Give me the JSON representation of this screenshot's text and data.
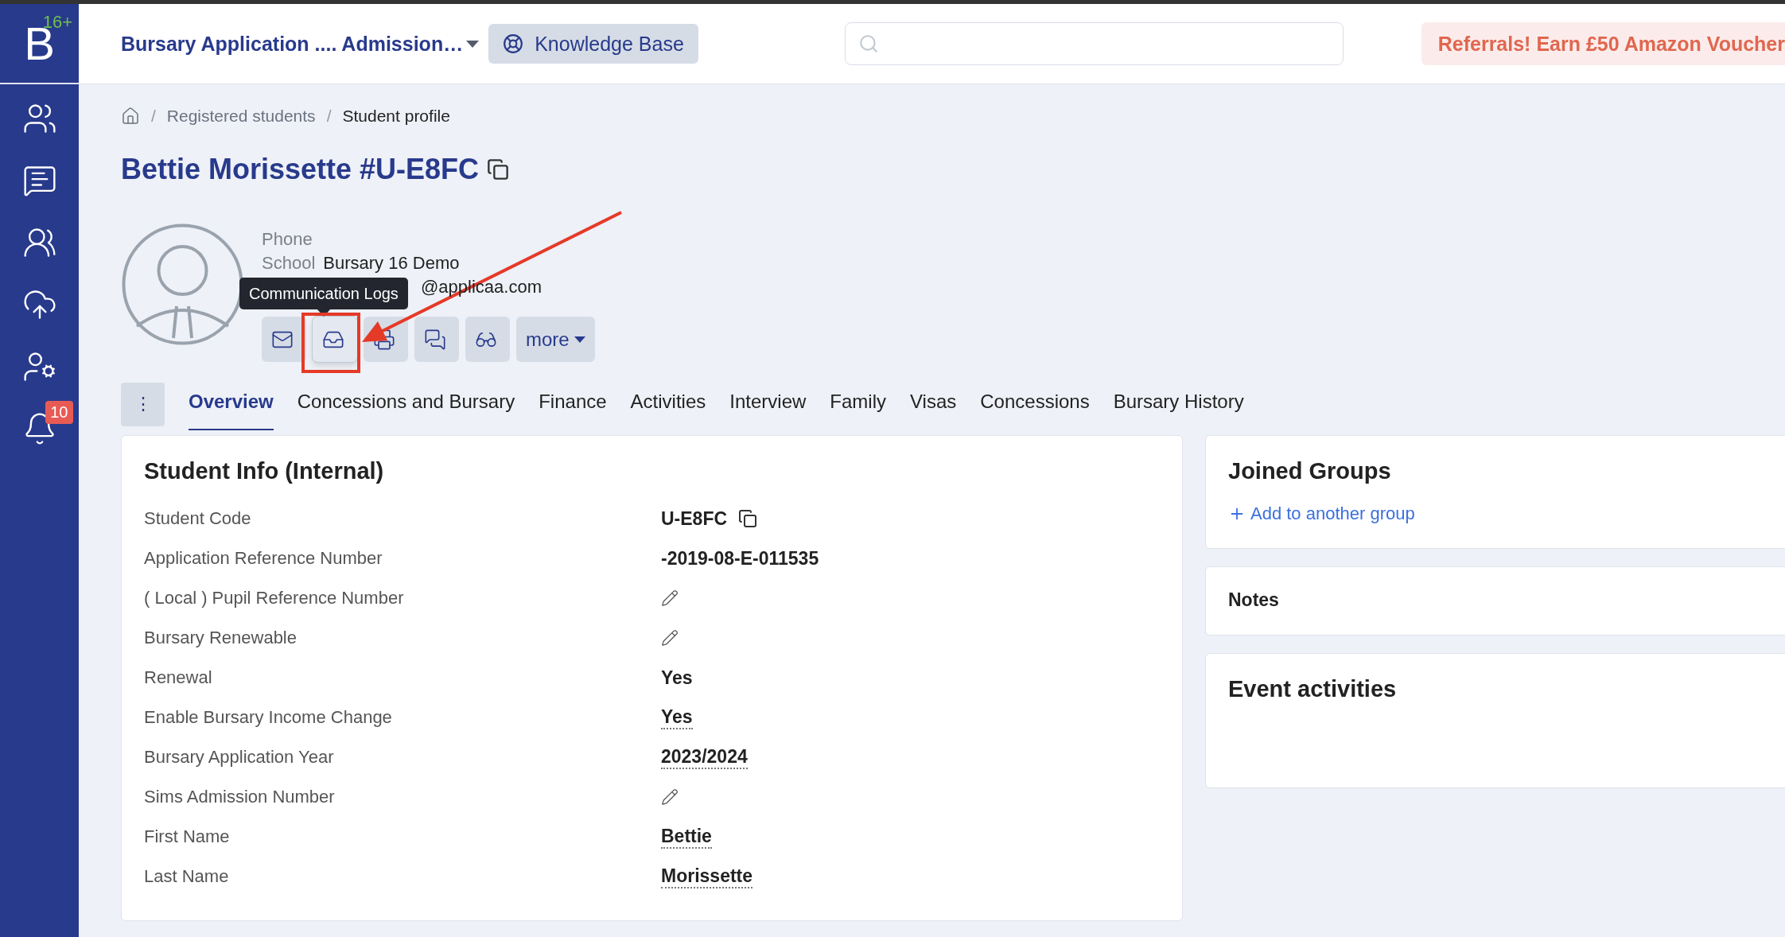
{
  "sidebar": {
    "logo": "B",
    "logo_badge": "16+",
    "items": [
      {
        "kind": "people"
      },
      {
        "kind": "messages"
      },
      {
        "kind": "groups"
      },
      {
        "kind": "upload"
      },
      {
        "kind": "settings"
      },
      {
        "kind": "bell",
        "badge": "10"
      }
    ]
  },
  "topbar": {
    "app_switcher": "Bursary Application .... Admission…",
    "knowledge_base": "Knowledge Base",
    "referral": "Referrals! Earn £50 Amazon Voucher"
  },
  "breadcrumbs": [
    "Registered students",
    "Student profile"
  ],
  "breadcrumb_separator": "/",
  "tabs_menu": "⋮",
  "profile": {
    "name": "Bettie Morissette",
    "code": "#U-E8FC",
    "info": [
      {
        "label": "Phone"
      },
      {
        "label": "School",
        "value": "Bursary 16 Demo"
      },
      {
        "value": "@applicaa.com"
      }
    ],
    "actions": [
      {
        "kind": "mail",
        "hovered": false
      },
      {
        "kind": "inbox",
        "hovered": true
      },
      {
        "kind": "print",
        "hovered": false
      },
      {
        "kind": "chat",
        "hovered": false
      },
      {
        "kind": "glasses",
        "hovered": false
      },
      {
        "kind": "more",
        "label": "more",
        "hovered": false
      }
    ],
    "tooltip": "Communication Logs"
  },
  "tabs": [
    {
      "label": "Overview",
      "selected": true
    },
    {
      "label": "Concessions and Bursary",
      "selected": false
    },
    {
      "label": "Finance",
      "selected": false
    },
    {
      "label": "Activities",
      "selected": false
    },
    {
      "label": "Interview",
      "selected": false
    },
    {
      "label": "Family",
      "selected": false
    },
    {
      "label": "Visas",
      "selected": false
    },
    {
      "label": "Concessions",
      "selected": false
    },
    {
      "label": "Bursary History",
      "selected": false
    }
  ],
  "student_info": {
    "title": "Student Info (Internal)",
    "rows": [
      {
        "label": "Student Code",
        "kind": "copy",
        "value": "U-E8FC"
      },
      {
        "label": "Application Reference Number",
        "kind": "text",
        "value": "-2019-08-E-011535"
      },
      {
        "label": "( Local ) Pupil Reference Number",
        "kind": "edit"
      },
      {
        "label": "Bursary Renewable",
        "kind": "edit"
      },
      {
        "label": "Renewal",
        "kind": "text",
        "value": "Yes"
      },
      {
        "label": "Enable Bursary Income Change",
        "kind": "dotted",
        "value": "Yes"
      },
      {
        "label": "Bursary Application Year",
        "kind": "dotted",
        "value": "2023/2024"
      },
      {
        "label": "Sims Admission Number",
        "kind": "edit"
      },
      {
        "label": "First Name",
        "kind": "dotted",
        "value": "Bettie"
      },
      {
        "label": "Last Name",
        "kind": "dotted",
        "value": "Morissette"
      }
    ]
  },
  "side_cards": [
    {
      "kind": "groups",
      "title": "Joined Groups",
      "link": "Add to another group"
    },
    {
      "kind": "notes",
      "title": "Notes"
    },
    {
      "kind": "events",
      "title": "Event activities"
    }
  ]
}
